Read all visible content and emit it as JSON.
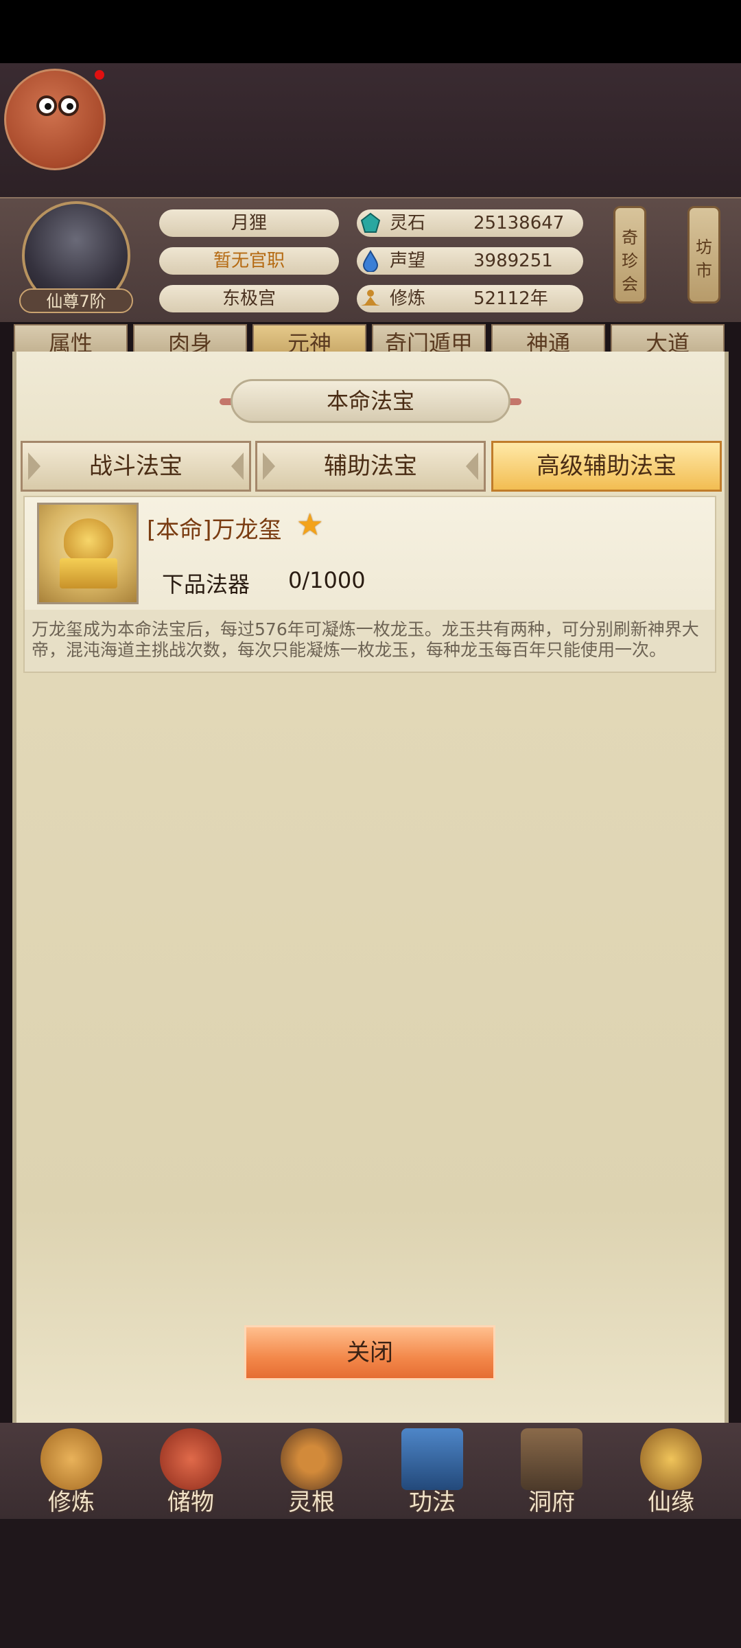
{
  "player": {
    "name": "月狸",
    "office": "暂无官职",
    "sect": "东极宫",
    "rank": "仙尊7阶"
  },
  "resources": [
    {
      "label": "灵石",
      "value": "25138647",
      "icon": "spirit-stone-icon",
      "color": "#2aa7a0"
    },
    {
      "label": "声望",
      "value": "3989251",
      "icon": "prestige-drop-icon",
      "color": "#3b7fd6"
    },
    {
      "label": "修炼",
      "value": "52112年",
      "icon": "meditation-icon",
      "color": "#c98a2a"
    }
  ],
  "side_buttons": {
    "treasure_fair": "奇珍会",
    "market": "坊市"
  },
  "main_tabs": [
    "属性",
    "肉身",
    "元神",
    "奇门遁甲",
    "神通",
    "大道"
  ],
  "modal": {
    "title": "本命法宝",
    "sub_tabs": [
      "战斗法宝",
      "辅助法宝",
      "高级辅助法宝"
    ],
    "active_sub_tab": "高级辅助法宝",
    "treasure": {
      "name": "[本命]万龙玺",
      "stars": 1,
      "grade": "下品法器",
      "progress": "0/1000",
      "description": "万龙玺成为本命法宝后，每过576年可凝炼一枚龙玉。龙玉共有两种，可分别刷新神界大帝，混沌海道主挑战次数，每次只能凝炼一枚龙玉，每种龙玉每百年只能使用一次。"
    },
    "close_label": "关闭"
  },
  "bottom_nav": [
    {
      "label": "修炼",
      "icon": "cultivate-icon"
    },
    {
      "label": "储物",
      "icon": "storage-bag-icon"
    },
    {
      "label": "灵根",
      "icon": "spirit-root-icon"
    },
    {
      "label": "功法",
      "icon": "technique-book-icon"
    },
    {
      "label": "洞府",
      "icon": "cave-dwelling-icon"
    },
    {
      "label": "仙缘",
      "icon": "immortal-fate-icon"
    }
  ],
  "colors": {
    "accent_orange": "#f3884a",
    "active_tab_gold": "#f2bd52",
    "office_text": "#b56a12",
    "star": "#f3a219"
  }
}
